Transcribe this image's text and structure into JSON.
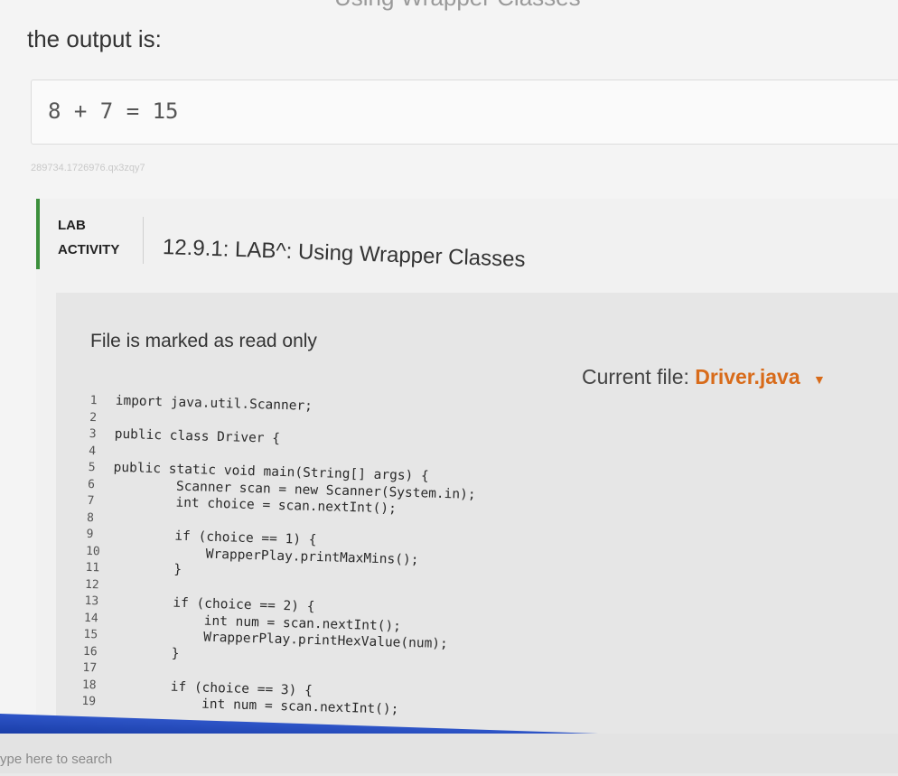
{
  "heading_fragment": "Using Wrapper Classes",
  "output_intro": "the output is:",
  "output_sample": "8 + 7 = 15",
  "activity_id": "289734.1726976.qx3zqy7",
  "lab": {
    "label_line1": "LAB",
    "label_line2": "ACTIVITY",
    "title": "12.9.1: LAB^: Using Wrapper Classes"
  },
  "editor": {
    "readonly_note": "File is marked as read only",
    "current_file_label": "Current file:",
    "current_file_name": "Driver.java",
    "lines": [
      {
        "n": "1",
        "code": "import java.util.Scanner;"
      },
      {
        "n": "2",
        "code": ""
      },
      {
        "n": "3",
        "code": "public class Driver {"
      },
      {
        "n": "4",
        "code": ""
      },
      {
        "n": "5",
        "code": "public static void main(String[] args) {"
      },
      {
        "n": "6",
        "code": "        Scanner scan = new Scanner(System.in);"
      },
      {
        "n": "7",
        "code": "        int choice = scan.nextInt();"
      },
      {
        "n": "8",
        "code": ""
      },
      {
        "n": "9",
        "code": "        if (choice == 1) {"
      },
      {
        "n": "10",
        "code": "            WrapperPlay.printMaxMins();"
      },
      {
        "n": "11",
        "code": "        }"
      },
      {
        "n": "12",
        "code": ""
      },
      {
        "n": "13",
        "code": "        if (choice == 2) {"
      },
      {
        "n": "14",
        "code": "            int num = scan.nextInt();"
      },
      {
        "n": "15",
        "code": "            WrapperPlay.printHexValue(num);"
      },
      {
        "n": "16",
        "code": "        }"
      },
      {
        "n": "17",
        "code": ""
      },
      {
        "n": "18",
        "code": "        if (choice == 3) {"
      },
      {
        "n": "19",
        "code": "            int num = scan.nextInt();"
      }
    ]
  },
  "taskbar_search": "ype here to search",
  "colors": {
    "accent_green": "#3c8f3c",
    "file_orange": "#d86b1a",
    "taskbar_blue": "#1a3ea8"
  }
}
